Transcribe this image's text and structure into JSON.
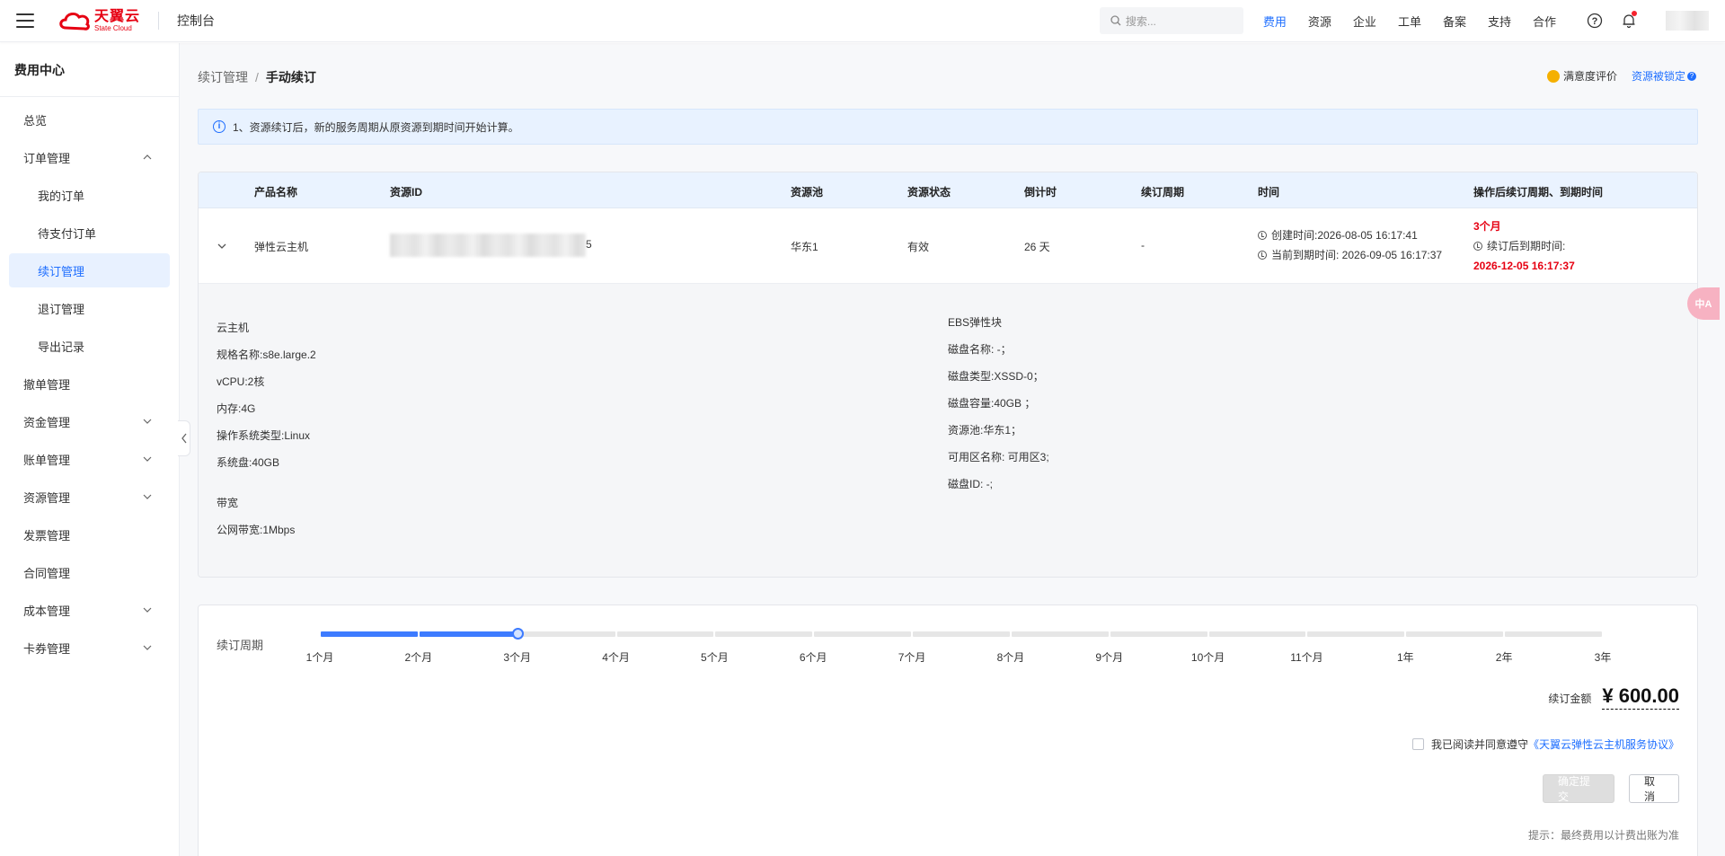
{
  "header": {
    "logo_cn": "天翼云",
    "logo_en": "State Cloud",
    "console_title": "控制台",
    "search_placeholder": "搜索...",
    "nav": [
      "费用",
      "资源",
      "企业",
      "工单",
      "备案",
      "支持",
      "合作"
    ],
    "active_nav": "费用",
    "accent_color": "#1f6fff",
    "brand_color": "#e60012"
  },
  "sidebar": {
    "title": "费用中心",
    "items": [
      {
        "label": "总览",
        "sub": false,
        "chevron": "none"
      },
      {
        "label": "订单管理",
        "sub": false,
        "chevron": "up"
      },
      {
        "label": "我的订单",
        "sub": true,
        "chevron": "none"
      },
      {
        "label": "待支付订单",
        "sub": true,
        "chevron": "none"
      },
      {
        "label": "续订管理",
        "sub": true,
        "chevron": "none",
        "active": true
      },
      {
        "label": "退订管理",
        "sub": true,
        "chevron": "none"
      },
      {
        "label": "导出记录",
        "sub": true,
        "chevron": "none"
      },
      {
        "label": "撤单管理",
        "sub": false,
        "chevron": "none"
      },
      {
        "label": "资金管理",
        "sub": false,
        "chevron": "down"
      },
      {
        "label": "账单管理",
        "sub": false,
        "chevron": "down"
      },
      {
        "label": "资源管理",
        "sub": false,
        "chevron": "down"
      },
      {
        "label": "发票管理",
        "sub": false,
        "chevron": "none"
      },
      {
        "label": "合同管理",
        "sub": false,
        "chevron": "none"
      },
      {
        "label": "成本管理",
        "sub": false,
        "chevron": "down"
      },
      {
        "label": "卡券管理",
        "sub": false,
        "chevron": "down"
      }
    ]
  },
  "breadcrumb": {
    "parent": "续订管理",
    "separator": "/",
    "current": "手动续订"
  },
  "top_actions": {
    "rating": "满意度评价",
    "locked": "资源被锁定"
  },
  "notice": {
    "icon": "info-icon",
    "text": "1、资源续订后，新的服务周期从原资源到期时间开始计算。"
  },
  "table": {
    "columns": [
      "产品名称",
      "资源ID",
      "资源池",
      "资源状态",
      "倒计时",
      "续订周期",
      "时间",
      "操作后续订周期、到期时间"
    ],
    "row": {
      "product": "弹性云主机",
      "resource_id_suffix": "5",
      "pool": "华东1",
      "status": "有效",
      "countdown": "26 天",
      "cycle": "-",
      "created": "创建时间:2026-08-05 16:17:41",
      "expire": "当前到期时间: 2026-09-05 16:17:37",
      "after_cycle": "3个月",
      "after_label": "续订后到期时间:",
      "after_expire": "2026-12-05 16:17:37"
    },
    "detail": {
      "left": [
        "云主机",
        "规格名称:s8e.large.2",
        "vCPU:2核",
        "内存:4G",
        "操作系统类型:Linux",
        "系统盘:40GB",
        "带宽",
        "公网带宽:1Mbps"
      ],
      "right": [
        "EBS弹性块",
        "磁盘名称: -；",
        "磁盘类型:XSSD-0；",
        "磁盘容量:40GB ；",
        "资源池:华东1；",
        "可用区名称: 可用区3;",
        "磁盘ID: -;"
      ]
    }
  },
  "renewal": {
    "label": "续订周期",
    "options": [
      "1个月",
      "2个月",
      "3个月",
      "4个月",
      "5个月",
      "6个月",
      "7个月",
      "8个月",
      "9个月",
      "10个月",
      "11个月",
      "1年",
      "2年",
      "3年"
    ],
    "selected": "3个月",
    "amount_label": "续订金额",
    "amount": "¥ 600.00",
    "agree_text": "我已阅读并同意遵守",
    "agreement_link": "《天翼云弹性云主机服务协议》",
    "agree_checked": false,
    "submit_label": "确定提交",
    "cancel_label": "取消",
    "hint": "提示：最终费用以计费出账为准"
  },
  "fab": {
    "label": "中A"
  }
}
